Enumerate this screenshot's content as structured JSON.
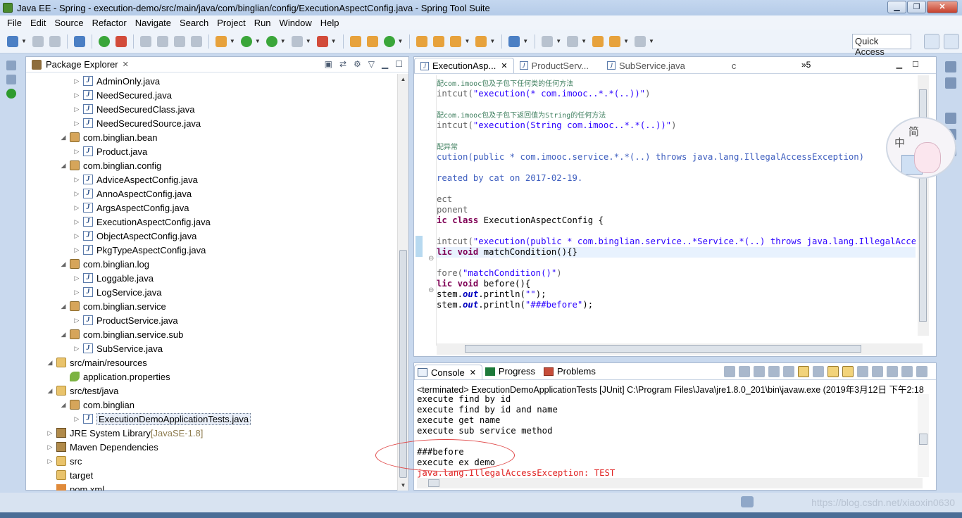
{
  "window": {
    "title": "Java EE - Spring - execution-demo/src/main/java/com/binglian/config/ExecutionAspectConfig.java - Spring Tool Suite",
    "minimize": "▁",
    "maximize": "❐",
    "close": "✕"
  },
  "menu": [
    "File",
    "Edit",
    "Source",
    "Refactor",
    "Navigate",
    "Search",
    "Project",
    "Run",
    "Window",
    "Help"
  ],
  "toolbar": {
    "quick_access": "Quick Access"
  },
  "package_explorer": {
    "title": "Package Explorer",
    "close": "✕",
    "items": [
      {
        "indent": 3,
        "twisty": "▷",
        "icon": "java",
        "label": "AdminOnly.java",
        "decor": ""
      },
      {
        "indent": 3,
        "twisty": "▷",
        "icon": "java",
        "label": "NeedSecured.java",
        "decor": ""
      },
      {
        "indent": 3,
        "twisty": "▷",
        "icon": "java",
        "label": "NeedSecuredClass.java",
        "decor": ""
      },
      {
        "indent": 3,
        "twisty": "▷",
        "icon": "java",
        "label": "NeedSecuredSource.java",
        "decor": ""
      },
      {
        "indent": 2,
        "twisty": "◢",
        "icon": "pkg",
        "label": "com.binglian.bean",
        "decor": ""
      },
      {
        "indent": 3,
        "twisty": "▷",
        "icon": "java",
        "label": "Product.java",
        "decor": ""
      },
      {
        "indent": 2,
        "twisty": "◢",
        "icon": "pkg",
        "label": "com.binglian.config",
        "decor": ""
      },
      {
        "indent": 3,
        "twisty": "▷",
        "icon": "java",
        "label": "AdviceAspectConfig.java",
        "decor": ""
      },
      {
        "indent": 3,
        "twisty": "▷",
        "icon": "java",
        "label": "AnnoAspectConfig.java",
        "decor": ""
      },
      {
        "indent": 3,
        "twisty": "▷",
        "icon": "java",
        "label": "ArgsAspectConfig.java",
        "decor": ""
      },
      {
        "indent": 3,
        "twisty": "▷",
        "icon": "java",
        "label": "ExecutionAspectConfig.java",
        "decor": ""
      },
      {
        "indent": 3,
        "twisty": "▷",
        "icon": "java",
        "label": "ObjectAspectConfig.java",
        "decor": ""
      },
      {
        "indent": 3,
        "twisty": "▷",
        "icon": "java",
        "label": "PkgTypeAspectConfig.java",
        "decor": ""
      },
      {
        "indent": 2,
        "twisty": "◢",
        "icon": "pkg",
        "label": "com.binglian.log",
        "decor": ""
      },
      {
        "indent": 3,
        "twisty": "▷",
        "icon": "java",
        "label": "Loggable.java",
        "decor": ""
      },
      {
        "indent": 3,
        "twisty": "▷",
        "icon": "java",
        "label": "LogService.java",
        "decor": ""
      },
      {
        "indent": 2,
        "twisty": "◢",
        "icon": "pkg",
        "label": "com.binglian.service",
        "decor": ""
      },
      {
        "indent": 3,
        "twisty": "▷",
        "icon": "java",
        "label": "ProductService.java",
        "decor": ""
      },
      {
        "indent": 2,
        "twisty": "◢",
        "icon": "pkg",
        "label": "com.binglian.service.sub",
        "decor": ""
      },
      {
        "indent": 3,
        "twisty": "▷",
        "icon": "java",
        "label": "SubService.java",
        "decor": ""
      },
      {
        "indent": 1,
        "twisty": "◢",
        "icon": "folder",
        "label": "src/main/resources",
        "decor": ""
      },
      {
        "indent": 2,
        "twisty": "",
        "icon": "prop",
        "label": "application.properties",
        "decor": ""
      },
      {
        "indent": 1,
        "twisty": "◢",
        "icon": "folder",
        "label": "src/test/java",
        "decor": ""
      },
      {
        "indent": 2,
        "twisty": "◢",
        "icon": "pkg",
        "label": "com.binglian",
        "decor": ""
      },
      {
        "indent": 3,
        "twisty": "▷",
        "icon": "java",
        "label": "ExecutionDemoApplicationTests.java",
        "decor": "",
        "selected": true
      },
      {
        "indent": 1,
        "twisty": "▷",
        "icon": "lib",
        "label": "JRE System Library",
        "decor": "[JavaSE-1.8]"
      },
      {
        "indent": 1,
        "twisty": "▷",
        "icon": "lib",
        "label": "Maven Dependencies",
        "decor": ""
      },
      {
        "indent": 1,
        "twisty": "▷",
        "icon": "folder",
        "label": "src",
        "decor": ""
      },
      {
        "indent": 1,
        "twisty": "",
        "icon": "folder",
        "label": "target",
        "decor": ""
      },
      {
        "indent": 1,
        "twisty": "",
        "icon": "xml",
        "label": "pom.xml",
        "decor": ""
      }
    ]
  },
  "editor": {
    "tabs": [
      {
        "label": "ExecutionAsp...",
        "active": true
      },
      {
        "label": "ProductServ...",
        "active": false
      },
      {
        "label": "SubService.java",
        "active": false
      },
      {
        "label": "c",
        "active": false
      }
    ],
    "overflow": "»5",
    "lines": [
      {
        "parts": [
          {
            "c": "cm",
            "t": "配com.imooc包及子包下任何类的任何方法"
          }
        ],
        "small": true
      },
      {
        "parts": [
          {
            "c": "ann",
            "t": "intcut("
          },
          {
            "c": "str",
            "t": "\"execution(* com.imooc..*.*(..))\""
          },
          {
            "c": "ann",
            "t": ")"
          }
        ]
      },
      {
        "parts": []
      },
      {
        "parts": [
          {
            "c": "cm",
            "t": "配com.imooc包及子包下返回值为String的任何方法"
          }
        ],
        "small": true
      },
      {
        "parts": [
          {
            "c": "ann",
            "t": "intcut("
          },
          {
            "c": "str",
            "t": "\"execution(String com.imooc..*.*(..))\""
          },
          {
            "c": "ann",
            "t": ")"
          }
        ]
      },
      {
        "parts": []
      },
      {
        "parts": [
          {
            "c": "cm",
            "t": "配异常"
          }
        ],
        "small": true
      },
      {
        "parts": [
          {
            "c": "cmj",
            "t": "cution(public * com.imooc.service.*.*(..) throws java.lang.IllegalAccessException)"
          }
        ]
      },
      {
        "parts": []
      },
      {
        "parts": [
          {
            "c": "cmj",
            "t": "reated by cat on 2017-02-19."
          }
        ]
      },
      {
        "parts": []
      },
      {
        "parts": [
          {
            "c": "ann",
            "t": "ect"
          }
        ]
      },
      {
        "parts": [
          {
            "c": "ann",
            "t": "ponent"
          }
        ]
      },
      {
        "parts": [
          {
            "c": "kw",
            "t": "ic class "
          },
          {
            "c": "",
            "t": "ExecutionAspectConfig {"
          }
        ]
      },
      {
        "parts": []
      },
      {
        "parts": [
          {
            "c": "ann",
            "t": "intcut("
          },
          {
            "c": "str",
            "t": "\"execution(public * com.binglian.service..*Service.*(..) throws java.lang.IllegalAccessExc"
          }
        ]
      },
      {
        "parts": [
          {
            "c": "kw",
            "t": "lic void "
          },
          {
            "c": "",
            "t": "matchCondition(){}"
          }
        ],
        "current": true
      },
      {
        "parts": []
      },
      {
        "parts": [
          {
            "c": "ann",
            "t": "fore("
          },
          {
            "c": "str",
            "t": "\"matchCondition()\""
          },
          {
            "c": "ann",
            "t": ")"
          }
        ]
      },
      {
        "parts": [
          {
            "c": "kw",
            "t": "lic void "
          },
          {
            "c": "",
            "t": "before(){"
          }
        ]
      },
      {
        "parts": [
          {
            "c": "",
            "t": "stem."
          },
          {
            "c": "it",
            "t": "out"
          },
          {
            "c": "",
            "t": ".println("
          },
          {
            "c": "str",
            "t": "\"\""
          },
          {
            "c": "",
            "t": ");"
          }
        ]
      },
      {
        "parts": [
          {
            "c": "",
            "t": "stem."
          },
          {
            "c": "it",
            "t": "out"
          },
          {
            "c": "",
            "t": ".println("
          },
          {
            "c": "str",
            "t": "\"###before\""
          },
          {
            "c": "",
            "t": ");"
          }
        ]
      }
    ]
  },
  "console": {
    "tabs": [
      "Console",
      "Progress",
      "Problems"
    ],
    "terminated": "<terminated> ExecutionDemoApplicationTests [JUnit] C:\\Program Files\\Java\\jre1.8.0_201\\bin\\javaw.exe (2019年3月12日 下午2:18",
    "lines": [
      {
        "t": "execute find by id",
        "err": false
      },
      {
        "t": "execute find by id and name",
        "err": false
      },
      {
        "t": "execute get name",
        "err": false
      },
      {
        "t": "execute sub service method",
        "err": false
      },
      {
        "t": "",
        "err": false
      },
      {
        "t": "###before",
        "err": false
      },
      {
        "t": "execute ex demo",
        "err": false
      },
      {
        "t": "java.lang.IllegalAccessException: TEST",
        "err": true
      }
    ]
  },
  "ime": {
    "char1": "简",
    "char2": "中"
  },
  "statusbar": {
    "watermark": "https://blog.csdn.net/xiaoxin0630"
  }
}
